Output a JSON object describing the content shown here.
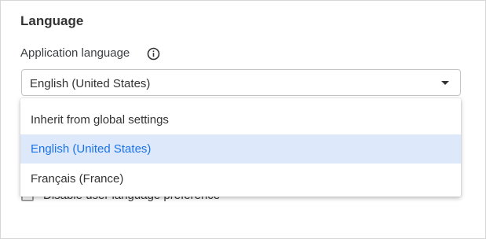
{
  "section": {
    "title": "Language"
  },
  "app_language": {
    "label": "Application language",
    "info_icon": "info-circle-icon",
    "selected_value": "English (United States)",
    "caret_icon": "caret-down-icon"
  },
  "dropdown": {
    "options": [
      {
        "label": "Inherit from global settings",
        "selected": false
      },
      {
        "label": "English (United States)",
        "selected": true
      },
      {
        "label": "Français (France)",
        "selected": false
      }
    ]
  },
  "obscured": {
    "checkbox_label": "Disable user language preference"
  },
  "colors": {
    "selected_bg": "#dde9fb",
    "selected_text": "#1a73e8",
    "border": "#c4c4c4"
  }
}
